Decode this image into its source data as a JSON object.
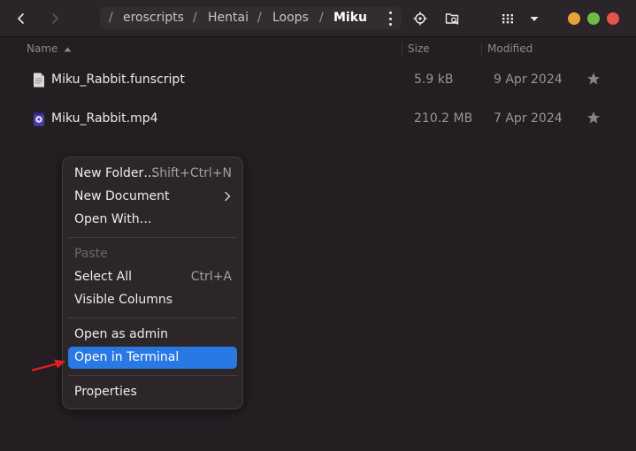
{
  "header": {
    "path": {
      "separators": [
        "/",
        "/",
        "/",
        "/"
      ],
      "crumbs": [
        "eroscripts",
        "Hentai",
        "Loops",
        "Miku"
      ]
    }
  },
  "columns": {
    "name": "Name",
    "size": "Size",
    "modified": "Modified"
  },
  "files": [
    {
      "name": "Miku_Rabbit.funscript",
      "size": "5.9 kB",
      "modified": "9 Apr 2024",
      "icon": "text-file-icon"
    },
    {
      "name": "Miku_Rabbit.mp4",
      "size": "210.2 MB",
      "modified": "7 Apr 2024",
      "icon": "video-file-icon"
    }
  ],
  "context_menu": {
    "new_folder": {
      "label": "New Folder…",
      "accel": "Shift+Ctrl+N"
    },
    "new_document": {
      "label": "New Document"
    },
    "open_with": {
      "label": "Open With…"
    },
    "paste": {
      "label": "Paste"
    },
    "select_all": {
      "label": "Select All",
      "accel": "Ctrl+A"
    },
    "visible_columns": {
      "label": "Visible Columns"
    },
    "open_as_admin": {
      "label": "Open as admin"
    },
    "open_in_terminal": {
      "label": "Open in Terminal"
    },
    "properties": {
      "label": "Properties"
    }
  },
  "colors": {
    "accent": "#2a78e4",
    "annotation_arrow": "#e02020",
    "close": "#e5534b",
    "minimize": "#e8a33a",
    "maximize": "#6cbd45"
  }
}
